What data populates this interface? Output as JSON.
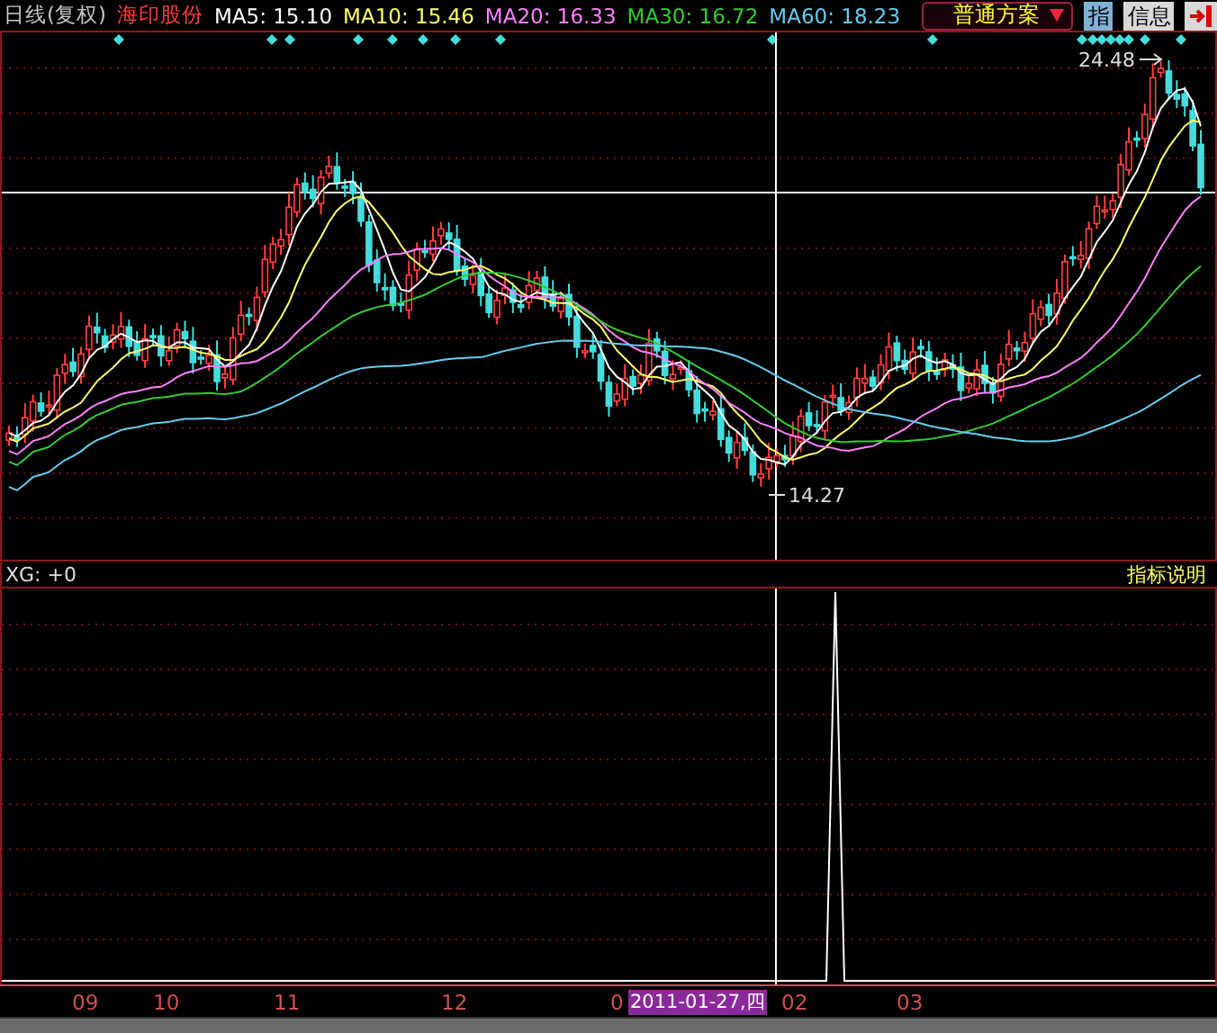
{
  "header": {
    "period": "日线(复权)",
    "stock_name": "海印股份",
    "moving_averages": [
      {
        "label": "MA5: 15.10",
        "color": "#ffffff"
      },
      {
        "label": "MA10: 15.46",
        "color": "#ffff66"
      },
      {
        "label": "MA20: 16.33",
        "color": "#ff80ff"
      },
      {
        "label": "MA30: 16.72",
        "color": "#33cc33"
      },
      {
        "label": "MA60: 18.23",
        "color": "#66ccee"
      }
    ],
    "scheme_dropdown": "普通方案",
    "buttons": [
      {
        "label": "指"
      },
      {
        "label": "信息"
      }
    ]
  },
  "price_chart": {
    "high_label": "24.48",
    "low_label": "14.27"
  },
  "indicator": {
    "reading": "XG: +0",
    "help_link": "指标说明"
  },
  "x_axis": {
    "labels": [
      "09",
      "10",
      "11",
      "12",
      "0",
      "02",
      "03"
    ],
    "cursor_date": "2011-01-27,四"
  }
}
